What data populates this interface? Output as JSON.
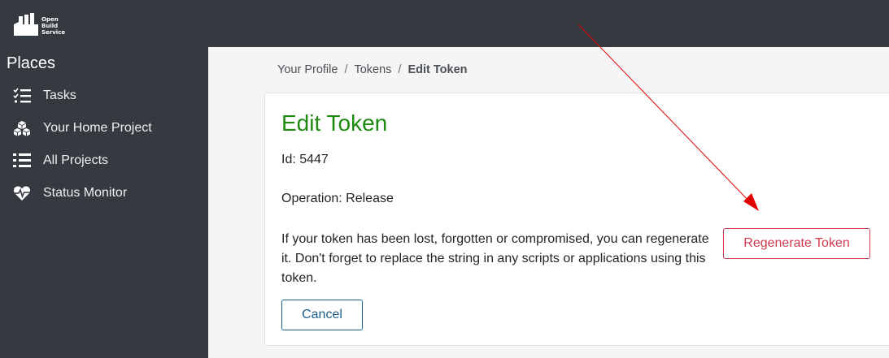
{
  "header": {
    "logo": {
      "icon": "factory-logo-icon",
      "lines": [
        "Open",
        "Build",
        "Service"
      ]
    }
  },
  "sidebar": {
    "title": "Places",
    "items": [
      {
        "label": "Tasks",
        "icon": "tasks-checklist-icon"
      },
      {
        "label": "Your Home Project",
        "icon": "cubes-icon"
      },
      {
        "label": "All Projects",
        "icon": "list-icon"
      },
      {
        "label": "Status Monitor",
        "icon": "heartbeat-icon"
      }
    ]
  },
  "breadcrumb": {
    "items": [
      "Your Profile",
      "Tokens",
      "Edit Token"
    ],
    "separator": "/"
  },
  "card": {
    "title": "Edit Token",
    "id_text": "Id: 5447",
    "operation_text": "Operation: Release",
    "description": "If your token has been lost, forgotten or compromised, you can regenerate it. Don't forget to replace the string in any scripts or applications using this token.",
    "regenerate_label": "Regenerate Token",
    "cancel_label": "Cancel"
  },
  "colors": {
    "topbar": "#353a40",
    "title_green": "#1e8a12",
    "danger": "#d13a4e",
    "primary": "#1a5f8a",
    "annotation_arrow": "#e00000"
  }
}
